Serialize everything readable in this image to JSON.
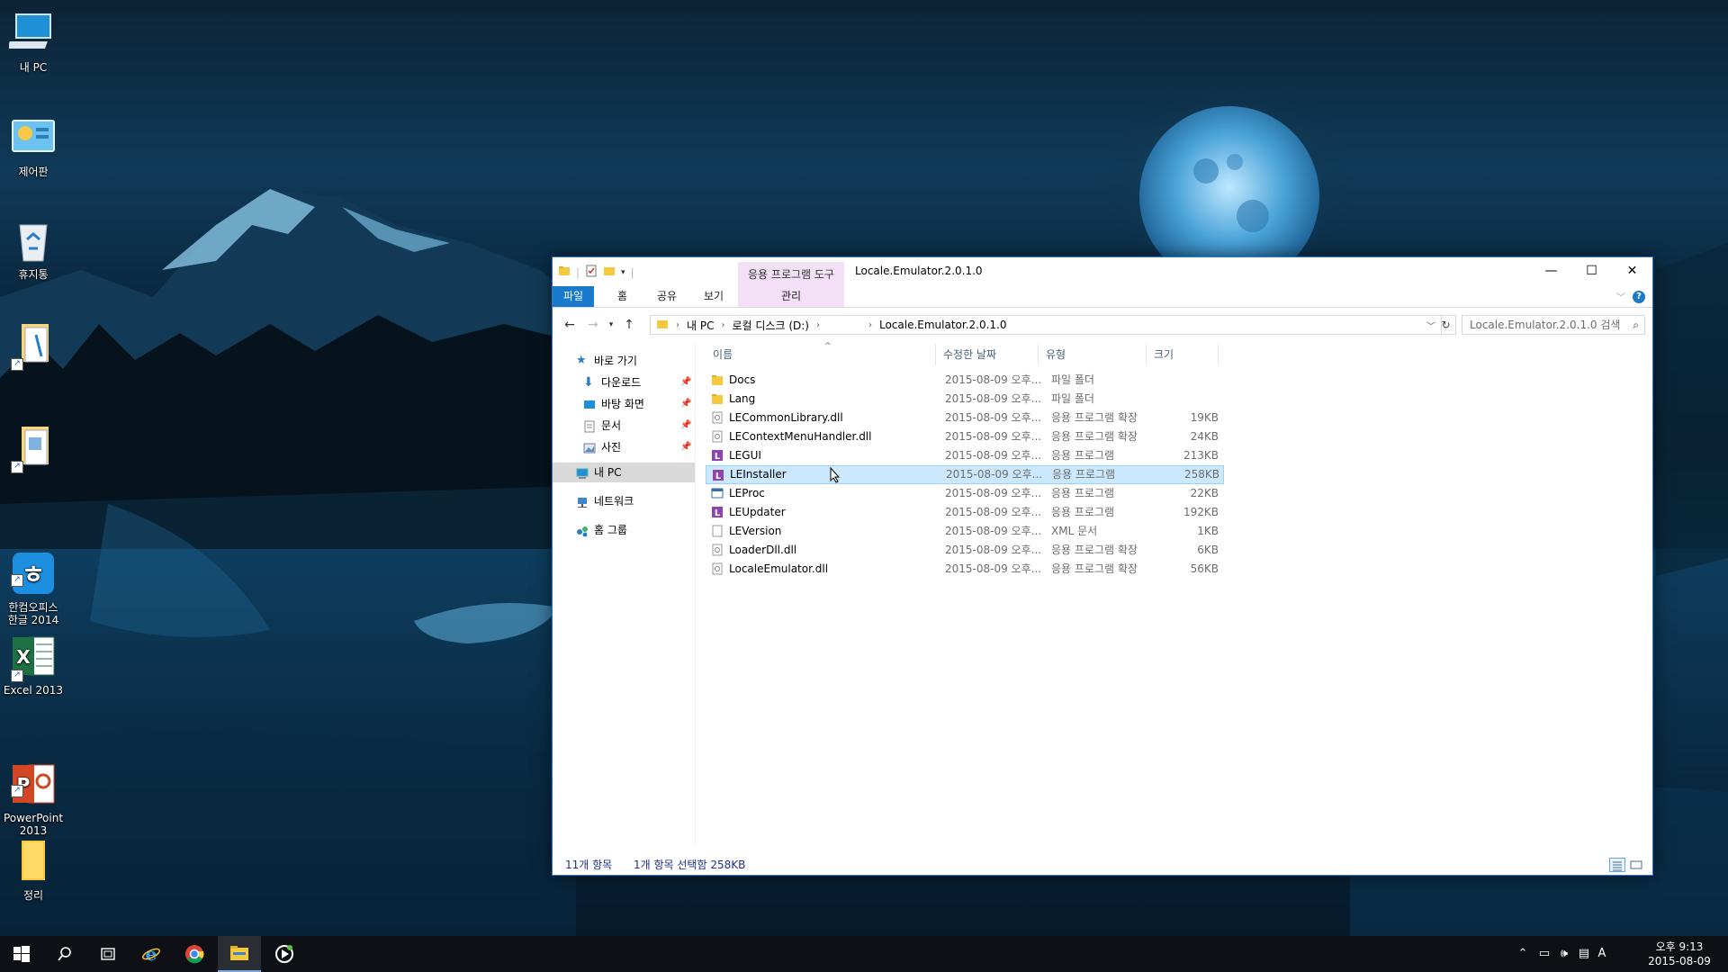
{
  "desktop": {
    "icons": [
      {
        "label": "내 PC",
        "icon": "computer-icon"
      },
      {
        "label": "제어판",
        "icon": "control-panel-icon"
      },
      {
        "label": "휴지통",
        "icon": "recycle-bin-icon"
      },
      {
        "label": "",
        "icon": "document-shortcut-icon"
      },
      {
        "label": "",
        "icon": "document-shortcut-icon"
      },
      {
        "label": "한컴오피스\n한글 2014",
        "icon": "hancom-hangul-icon"
      },
      {
        "label": "Excel 2013",
        "icon": "excel-icon"
      },
      {
        "label": "PowerPoint\n2013",
        "icon": "powerpoint-icon"
      },
      {
        "label": "정리",
        "icon": "folder-icon"
      }
    ]
  },
  "explorer": {
    "title": "Locale.Emulator.2.0.1.0",
    "context_tab_group": "응용 프로그램 도구",
    "ribbon_tabs": [
      "파일",
      "홈",
      "공유",
      "보기",
      "관리"
    ],
    "address": {
      "crumbs": [
        "내 PC",
        "로컬 디스크 (D:)",
        "Locale.Emulator.2.0.1.0"
      ]
    },
    "search_placeholder": "Locale.Emulator.2.0.1.0 검색",
    "nav": {
      "quick_access": "바로 가기",
      "pinned": [
        "다운로드",
        "바탕 화면",
        "문서",
        "사진"
      ],
      "this_pc": "내 PC",
      "network": "네트워크",
      "homegroup": "홈 그룹"
    },
    "columns": [
      "이름",
      "수정한 날짜",
      "유형",
      "크기"
    ],
    "files": [
      {
        "name": "Docs",
        "date": "2015-08-09 오후...",
        "type": "파일 폴더",
        "size": "",
        "kind": "folder"
      },
      {
        "name": "Lang",
        "date": "2015-08-09 오후...",
        "type": "파일 폴더",
        "size": "",
        "kind": "folder"
      },
      {
        "name": "LECommonLibrary.dll",
        "date": "2015-08-09 오후...",
        "type": "응용 프로그램 확장",
        "size": "19KB",
        "kind": "dll"
      },
      {
        "name": "LEContextMenuHandler.dll",
        "date": "2015-08-09 오후...",
        "type": "응용 프로그램 확장",
        "size": "24KB",
        "kind": "dll"
      },
      {
        "name": "LEGUI",
        "date": "2015-08-09 오후...",
        "type": "응용 프로그램",
        "size": "213KB",
        "kind": "exe-purple"
      },
      {
        "name": "LEInstaller",
        "date": "2015-08-09 오후...",
        "type": "응용 프로그램",
        "size": "258KB",
        "kind": "exe-purple"
      },
      {
        "name": "LEProc",
        "date": "2015-08-09 오후...",
        "type": "응용 프로그램",
        "size": "22KB",
        "kind": "exe-blue"
      },
      {
        "name": "LEUpdater",
        "date": "2015-08-09 오후...",
        "type": "응용 프로그램",
        "size": "192KB",
        "kind": "exe-purple"
      },
      {
        "name": "LEVersion",
        "date": "2015-08-09 오후...",
        "type": "XML 문서",
        "size": "1KB",
        "kind": "xml"
      },
      {
        "name": "LoaderDll.dll",
        "date": "2015-08-09 오후...",
        "type": "응용 프로그램 확장",
        "size": "6KB",
        "kind": "dll"
      },
      {
        "name": "LocaleEmulator.dll",
        "date": "2015-08-09 오후...",
        "type": "응용 프로그램 확장",
        "size": "56KB",
        "kind": "dll"
      }
    ],
    "selected_file": "LEInstaller",
    "status": {
      "count": "11개 항목",
      "selection": "1개 항목 선택함 258KB"
    }
  },
  "taskbar": {
    "pinned": [
      "start-icon",
      "search-icon",
      "task-view-icon",
      "internet-explorer-icon",
      "chrome-icon",
      "file-explorer-icon",
      "media-player-icon"
    ],
    "active": "file-explorer-icon",
    "ime": "A",
    "time": "오후 9:13",
    "date": "2015-08-09"
  },
  "colors": {
    "accent": "#1979ca",
    "selection": "#cce8ff",
    "context_tab": "#f3e0f7"
  }
}
